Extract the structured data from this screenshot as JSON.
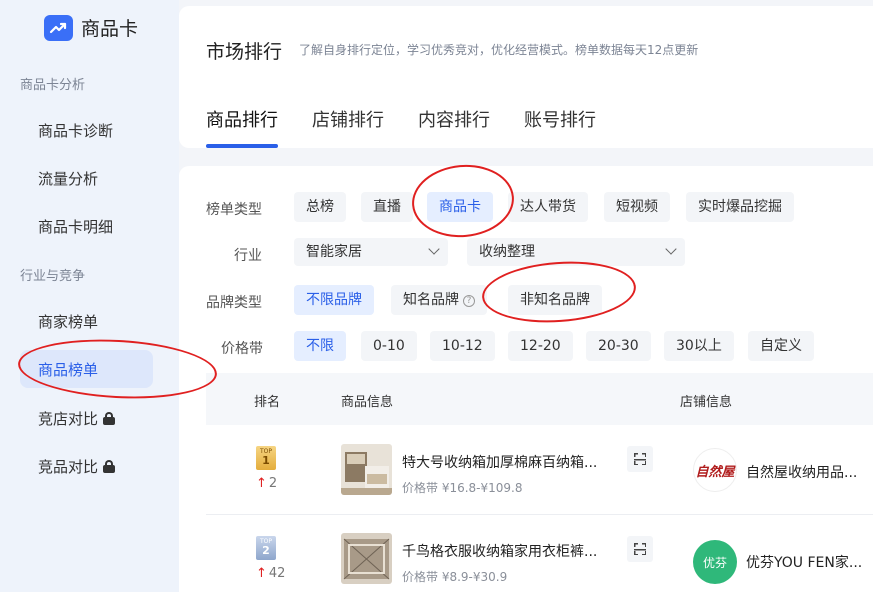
{
  "app": {
    "logo_text": "商品卡"
  },
  "sidebar": {
    "groups": [
      {
        "label": "商品卡分析",
        "items": [
          {
            "label": "商品卡诊断"
          },
          {
            "label": "流量分析"
          },
          {
            "label": "商品卡明细"
          }
        ]
      },
      {
        "label": "行业与竞争",
        "items": [
          {
            "label": "商家榜单"
          },
          {
            "label": "商品榜单",
            "active": true
          },
          {
            "label": "竞店对比",
            "locked": true
          },
          {
            "label": "竞品对比",
            "locked": true
          }
        ]
      }
    ]
  },
  "header": {
    "title": "市场排行",
    "description": "了解自身排行定位，学习优秀竞对，优化经营模式。榜单数据每天12点更新",
    "tabs": [
      {
        "label": "商品排行",
        "active": true
      },
      {
        "label": "店铺排行"
      },
      {
        "label": "内容排行"
      },
      {
        "label": "账号排行"
      }
    ]
  },
  "filters": {
    "list_type": {
      "label": "榜单类型",
      "options": [
        "总榜",
        "直播",
        "商品卡",
        "达人带货",
        "短视频",
        "实时爆品挖掘"
      ],
      "selected": "商品卡"
    },
    "industry": {
      "label": "行业",
      "primary": "智能家居",
      "secondary": "收纳整理"
    },
    "brand_type": {
      "label": "品牌类型",
      "options": [
        "不限品牌",
        "知名品牌",
        "非知名品牌"
      ],
      "selected": "不限品牌",
      "help_glyph": "?"
    },
    "price_band": {
      "label": "价格带",
      "options": [
        "不限",
        "0-10",
        "10-12",
        "12-20",
        "20-30",
        "30以上",
        "自定义"
      ],
      "selected": "不限"
    }
  },
  "table": {
    "columns": [
      "排名",
      "商品信息",
      "店铺信息"
    ],
    "rows": [
      {
        "rank_tag": "TOP",
        "rank": "1",
        "change_arrow": "↑",
        "change": "2",
        "product": "特大号收纳箱加厚棉麻百纳箱...",
        "price": "价格带 ¥16.8-¥109.8",
        "store_logo_text": "自然屋",
        "store": "自然屋收纳用品..."
      },
      {
        "rank_tag": "TOP",
        "rank": "2",
        "change_arrow": "↑",
        "change": "42",
        "product": "千鸟格衣服收纳箱家用衣柜裤...",
        "price": "价格带 ¥8.9-¥30.9",
        "store_logo_text": "优芬",
        "store": "优芬YOU FEN家..."
      }
    ]
  },
  "colors": {
    "accent": "#2a5fe8",
    "annotation": "#e02020",
    "sidebar_bg": "#eef3fb"
  }
}
